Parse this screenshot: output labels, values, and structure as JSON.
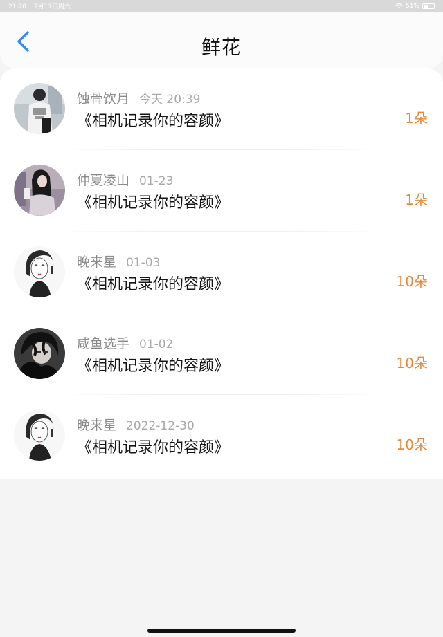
{
  "status_bar": {
    "time": "21:20",
    "date": "2月11日周六",
    "battery": "51%",
    "battery_level": 0.51,
    "wifi_icon": "wifi-icon"
  },
  "navbar": {
    "title": "鲜花",
    "back_icon": "chevron-left-icon"
  },
  "items": [
    {
      "user": "蚀骨饮月",
      "date": "今天 20:39",
      "book": "《相机记录你的容颜》",
      "count": "1朵",
      "avatar": "avatar-photo-sweater"
    },
    {
      "user": "仲夏凌山",
      "date": "01-23",
      "book": "《相机记录你的容颜》",
      "count": "1朵",
      "avatar": "avatar-photo-girl-phone"
    },
    {
      "user": "晚来星",
      "date": "01-03",
      "book": "《相机记录你的容颜》",
      "count": "10朵",
      "avatar": "avatar-sketch-girl"
    },
    {
      "user": "咸鱼选手",
      "date": "01-02",
      "book": "《相机记录你的容颜》",
      "count": "10朵",
      "avatar": "avatar-anime-boy"
    },
    {
      "user": "晚来星",
      "date": "2022-12-30",
      "book": "《相机记录你的容颜》",
      "count": "10朵",
      "avatar": "avatar-sketch-girl"
    }
  ],
  "colors": {
    "accent_blue": "#2d8cf0",
    "count_orange": "#e8893a",
    "page_bg": "#f4f4f4"
  }
}
